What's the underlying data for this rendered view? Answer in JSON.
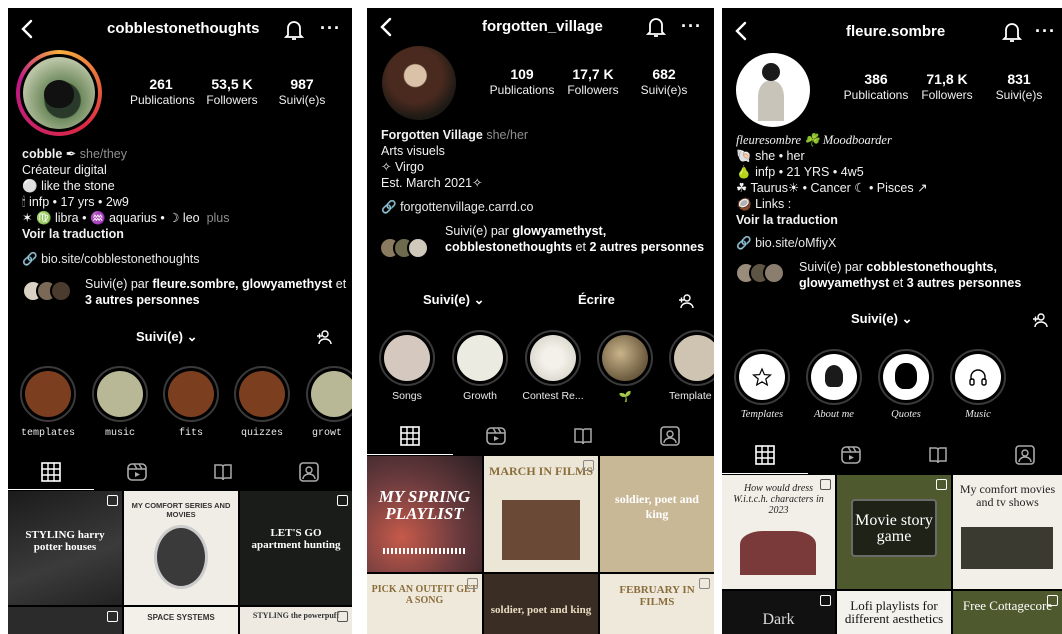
{
  "screens": [
    {
      "username": "cobblestonethoughts",
      "stats": [
        {
          "n": "261",
          "l": "Publications"
        },
        {
          "n": "53,5 K",
          "l": "Followers"
        },
        {
          "n": "987",
          "l": "Suivi(e)s"
        }
      ],
      "bio": {
        "name": "cobble",
        "pronoun": "she/they",
        "line1": "Créateur digital",
        "line2": "like the stone",
        "line3": "infp • 17 yrs • 2w9",
        "line4": "♍ libra • ♒ aquarius • ☽ leo",
        "more": "plus",
        "translate": "Voir la traduction"
      },
      "link": "bio.site/cobblestonethoughts",
      "followed_by": {
        "prefix": "Suivi(e) par ",
        "users": "fleure.sombre, glowyamethyst",
        "mid": " et ",
        "others": "3 autres personnes"
      },
      "follow_button": "Suivi(e)",
      "highlights": [
        "templates",
        "music",
        "fits",
        "quizzes",
        "growt"
      ],
      "tiles": [
        {
          "text": "STYLING harry potter houses"
        },
        {
          "text": "MY COMFORT SERIES AND MOVIES"
        },
        {
          "text": "LET'S GO apartment hunting"
        },
        {
          "text": ""
        },
        {
          "text": "SPACE SYSTEMS"
        },
        {
          "text": "STYLING the powerpuff"
        }
      ]
    },
    {
      "username": "forgotten_village",
      "stats": [
        {
          "n": "109",
          "l": "Publications"
        },
        {
          "n": "17,7 K",
          "l": "Followers"
        },
        {
          "n": "682",
          "l": "Suivi(e)s"
        }
      ],
      "bio": {
        "name": "Forgotten Village",
        "pronoun": "she/her",
        "line1": "Arts visuels",
        "line2": "✧ Virgo",
        "line3": "Est. March 2021✧"
      },
      "link": "forgottenvillage.carrd.co",
      "followed_by": {
        "prefix": "Suivi(e) par ",
        "users": "glowyamethyst, cobblestonethoughts",
        "mid": " et ",
        "others": "2 autres personnes"
      },
      "follow_button": "Suivi(e)",
      "message_button": "Écrire",
      "highlights": [
        "Songs",
        "Growth",
        "Contest Re...",
        "🌱",
        "Template"
      ],
      "tiles": [
        {
          "text": "MY SPRING PLAYLIST"
        },
        {
          "text": "MARCH IN FILMS"
        },
        {
          "text": "soldier, poet and king"
        },
        {
          "text": "PICK AN OUTFIT GET A SONG"
        },
        {
          "text": "soldier, poet and king"
        },
        {
          "text": "FEBRUARY IN FILMS"
        }
      ]
    },
    {
      "username": "fleure.sombre",
      "stats": [
        {
          "n": "386",
          "l": "Publications"
        },
        {
          "n": "71,8 K",
          "l": "Followers"
        },
        {
          "n": "831",
          "l": "Suivi(e)s"
        }
      ],
      "bio": {
        "name": "fleuresombre ☘️ Moodboarder",
        "line1": "she • her",
        "line2": "infp • 21 YRS • 4w5",
        "line3": "Taurus☀ • Cancer ☾ • Pisces ↗",
        "line4": "Links :",
        "translate": "Voir la traduction"
      },
      "link": "bio.site/oMfiyX",
      "followed_by": {
        "prefix": "Suivi(e) par ",
        "users": "cobblestonethoughts, glowyamethyst",
        "mid": " et ",
        "others": "3 autres personnes"
      },
      "follow_button": "Suivi(e)",
      "highlights": [
        "Templates",
        "About me",
        "Quotes",
        "Music"
      ],
      "tiles": [
        {
          "text": "How would dress W.i.t.c.h. characters in 2023"
        },
        {
          "text": "Movie story game"
        },
        {
          "text": "My comfort movies and tv shows"
        },
        {
          "text": "Dark"
        },
        {
          "text": "Lofi playlists for different aesthetics"
        },
        {
          "text": "Free Cottagecore"
        }
      ]
    }
  ],
  "colors": {
    "bg": "#000000",
    "text": "#ffffff",
    "dim": "#8e8e8e",
    "highlight_ring": "#3a3a3a"
  }
}
